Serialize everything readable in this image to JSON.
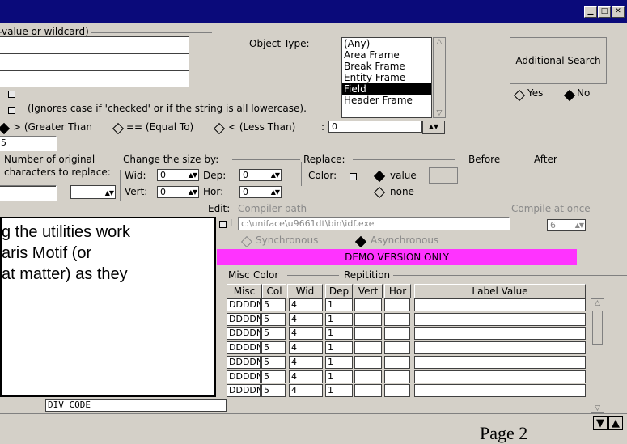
{
  "window": {
    "min": "▁",
    "max": "□",
    "close": "✕"
  },
  "search": {
    "group_label": "value or wildcard)",
    "ignore_case_text": "(Ignores case if 'checked' or if the string is all lowercase).",
    "compare": {
      "gt": "> (Greater Than",
      "eq": "== (Equal To)",
      "lt": "< (Less Than)",
      "colon": ":",
      "value": "0"
    },
    "small_value": "5"
  },
  "object_type": {
    "label": "Object Type:",
    "items": [
      "(Any)",
      "Area Frame",
      "Break Frame",
      "Entity Frame",
      "Field",
      "Header Frame"
    ],
    "selected": "Field"
  },
  "additional_search": {
    "button": "Additional Search",
    "yes": "Yes",
    "no": "No"
  },
  "replace_section": {
    "orig_line1": "Number of original",
    "orig_line2": "characters to replace:",
    "change_size_label": "Change the size by:",
    "wid_label": "Wid:",
    "wid_value": "0",
    "dep_label": "Dep:",
    "dep_value": "0",
    "vert_label": "Vert:",
    "vert_value": "0",
    "hor_label": "Hor:",
    "hor_value": "0",
    "replace_label": "Replace:",
    "color_label": "Color:",
    "value_option": "value",
    "none_option": "none",
    "before": "Before",
    "after": "After"
  },
  "edit": {
    "group_label": "Edit:",
    "compiler_label": "Compiler path",
    "compiler_value": "c:\\uniface\\u9661dt\\bin\\idf.exe",
    "compile_once_label": "Compile at once",
    "compile_once_value": "6",
    "synchronous": "Synchronous",
    "asynchronous": "Asynchronous"
  },
  "demo_banner": "DEMO VERSION ONLY",
  "grid": {
    "misc_group": "Misc",
    "color_group": "Color",
    "repetition_group": "Repitition",
    "headers": {
      "misc": "Misc",
      "col": "Col",
      "wid": "Wid",
      "dep": "Dep",
      "vert": "Vert",
      "hor": "Hor",
      "label": "Label Value"
    },
    "rows": [
      {
        "misc": "DDDDN",
        "col": "5",
        "wid": "4",
        "dep": "1"
      },
      {
        "misc": "DDDDN",
        "col": "5",
        "wid": "4",
        "dep": "1"
      },
      {
        "misc": "DDDDN",
        "col": "5",
        "wid": "4",
        "dep": "1"
      },
      {
        "misc": "DDDDN",
        "col": "5",
        "wid": "4",
        "dep": "1"
      },
      {
        "misc": "DDDDN",
        "col": "5",
        "wid": "4",
        "dep": "1"
      },
      {
        "misc": "DDDDN",
        "col": "5",
        "wid": "4",
        "dep": "1"
      },
      {
        "misc": "DDDDN",
        "col": "5",
        "wid": "4",
        "dep": "1"
      }
    ],
    "left_cell": "DIV CODE"
  },
  "popup": {
    "line1": "g the utilities work",
    "line2": "aris Motif (or",
    "line3": "at matter) as they"
  },
  "footer": {
    "page": "Page 2",
    "down": "▼",
    "up": "▲"
  }
}
